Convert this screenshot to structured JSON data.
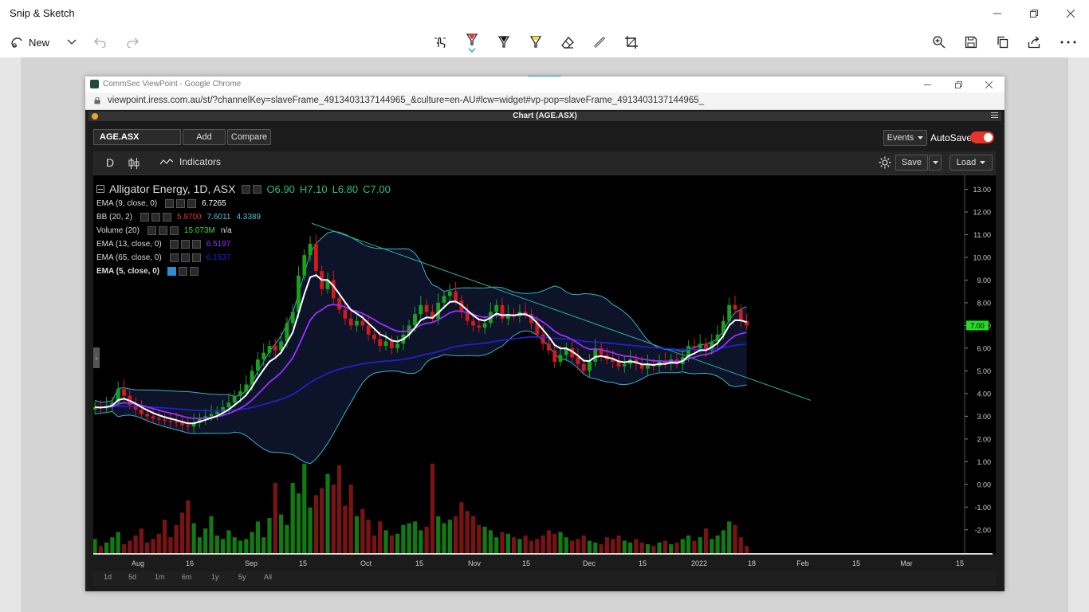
{
  "app": {
    "title": "Snip & Sketch",
    "new_label": "New"
  },
  "chrome": {
    "title": "CommSec ViewPoint - Google Chrome",
    "url": "viewpoint.iress.com.au/st/?channelKey=slaveFrame_4913403137144965_&culture=en-AU#lcw=widget#vp-pop=slaveFrame_4913403137144965_"
  },
  "widget": {
    "title": "Chart (AGE.ASX)",
    "symbol": "AGE.ASX",
    "add_label": "Add",
    "compare_label": "Compare",
    "events_label": "Events",
    "autosave_label": "AutoSave",
    "period": "D",
    "indicators_label": "Indicators",
    "save_label": "Save",
    "load_label": "Load"
  },
  "legend": {
    "title": "Alligator Energy, 1D, ASX",
    "ohlc": {
      "o": "O6.90",
      "h": "H7.10",
      "l": "L6.80",
      "c": "C7.00"
    },
    "rows": [
      {
        "name": "EMA (9, close, 0)",
        "values": [
          "6.7265"
        ],
        "colors": [
          "#ffffff"
        ]
      },
      {
        "name": "BB (20, 2)",
        "values": [
          "5.9700",
          "7.6011",
          "4.3389"
        ],
        "colors": [
          "#e8322b",
          "#4fc3d9",
          "#4fc3d9"
        ]
      },
      {
        "name": "Volume (20)",
        "values": [
          "15.073M",
          "n/a"
        ],
        "colors": [
          "#33dd33",
          "#dddddd"
        ]
      },
      {
        "name": "EMA (13, close, 0)",
        "values": [
          "6.5197"
        ],
        "colors": [
          "#9b30ff"
        ]
      },
      {
        "name": "EMA (65, close, 0)",
        "values": [
          "6.1537"
        ],
        "colors": [
          "#2222dd"
        ]
      },
      {
        "name": "EMA (5, close, 0)",
        "values": [],
        "colors": []
      }
    ]
  },
  "range_buttons": [
    "1d",
    "5d",
    "1m",
    "6m",
    "1y",
    "5y",
    "All"
  ],
  "colors": {
    "up": "#1aa31a",
    "down": "#d11a1a",
    "ema5": "#ffffff",
    "ema13": "#9b30ff",
    "ema65": "#2222dd",
    "bb": "#3ab0c8",
    "price_tag": "#22dd22"
  },
  "chart_data": {
    "type": "candlestick",
    "title": "Alligator Energy, 1D, ASX",
    "y_ticks": [
      "13.00",
      "12.00",
      "11.00",
      "10.00",
      "9.00",
      "8.00",
      "7.00",
      "6.00",
      "5.00",
      "4.00",
      "3.00",
      "2.00",
      "1.00",
      "0.00",
      "-1.00",
      "-2.00"
    ],
    "ylim": [
      -2.85,
      13.3
    ],
    "x_ticks": [
      "Aug",
      "16",
      "Sep",
      "15",
      "Oct",
      "15",
      "Nov",
      "15",
      "Dec",
      "15",
      "2022",
      "18",
      "Feb",
      "15",
      "Mar",
      "15"
    ],
    "last_price": "7.00",
    "close": [
      3.4,
      3.35,
      3.45,
      3.6,
      4.2,
      3.9,
      3.5,
      3.3,
      3.1,
      3.0,
      2.9,
      2.85,
      2.8,
      2.75,
      2.7,
      2.6,
      2.55,
      2.7,
      2.9,
      3.0,
      3.1,
      3.2,
      3.4,
      3.6,
      3.9,
      4.1,
      4.4,
      5.0,
      5.5,
      5.8,
      6.1,
      5.9,
      6.3,
      7.1,
      7.6,
      9.2,
      10.1,
      10.6,
      9.4,
      8.6,
      9.0,
      8.2,
      7.7,
      7.3,
      7.0,
      7.2,
      7.0,
      6.6,
      6.4,
      6.1,
      6.3,
      6.0,
      6.2,
      6.6,
      7.0,
      7.5,
      7.9,
      7.6,
      7.3,
      8.0,
      8.3,
      8.5,
      8.1,
      7.6,
      7.2,
      7.0,
      6.9,
      7.1,
      7.6,
      7.9,
      7.3,
      7.5,
      7.4,
      7.6,
      7.5,
      7.1,
      6.6,
      6.2,
      5.9,
      5.4,
      5.7,
      6.0,
      5.6,
      5.3,
      5.0,
      5.4,
      6.0,
      5.7,
      5.5,
      5.4,
      5.2,
      5.3,
      5.5,
      5.3,
      5.1,
      5.3,
      5.2,
      5.4,
      5.3,
      5.5,
      5.3,
      5.6,
      6.1,
      6.0,
      6.2,
      5.9,
      6.3,
      6.6,
      7.2,
      7.9,
      7.7,
      7.2,
      7.0
    ],
    "volume": [
      0.8,
      0.4,
      0.6,
      0.9,
      1.2,
      0.5,
      0.7,
      1.0,
      1.4,
      0.6,
      0.8,
      1.1,
      1.9,
      0.9,
      1.6,
      2.3,
      3.0,
      1.7,
      0.9,
      1.4,
      2.1,
      1.0,
      0.8,
      1.3,
      0.9,
      0.7,
      0.8,
      1.2,
      1.8,
      0.9,
      2.0,
      4.0,
      2.2,
      1.6,
      4.0,
      3.4,
      5.1,
      2.6,
      3.3,
      3.7,
      4.5,
      3.9,
      5.0,
      2.7,
      3.9,
      2.1,
      2.5,
      1.9,
      1.0,
      1.8,
      1.3,
      1.0,
      1.1,
      1.6,
      1.7,
      1.8,
      1.3,
      1.5,
      5.1,
      2.1,
      1.7,
      1.9,
      2.1,
      2.9,
      2.4,
      2.1,
      1.6,
      1.5,
      1.3,
      0.9,
      1.2,
      1.1,
      0.9,
      0.8,
      1.0,
      0.7,
      0.8,
      1.0,
      1.3,
      1.1,
      1.2,
      0.9,
      0.7,
      0.8,
      1.0,
      0.7,
      0.6,
      0.5,
      0.9,
      0.8,
      1.0,
      0.7,
      0.6,
      0.8,
      0.6,
      0.5,
      0.4,
      0.6,
      0.7,
      0.5,
      0.6,
      0.8,
      1.0,
      0.7,
      0.9,
      1.4,
      0.8,
      1.0,
      1.3,
      1.8,
      1.6,
      0.9,
      0.4
    ]
  }
}
